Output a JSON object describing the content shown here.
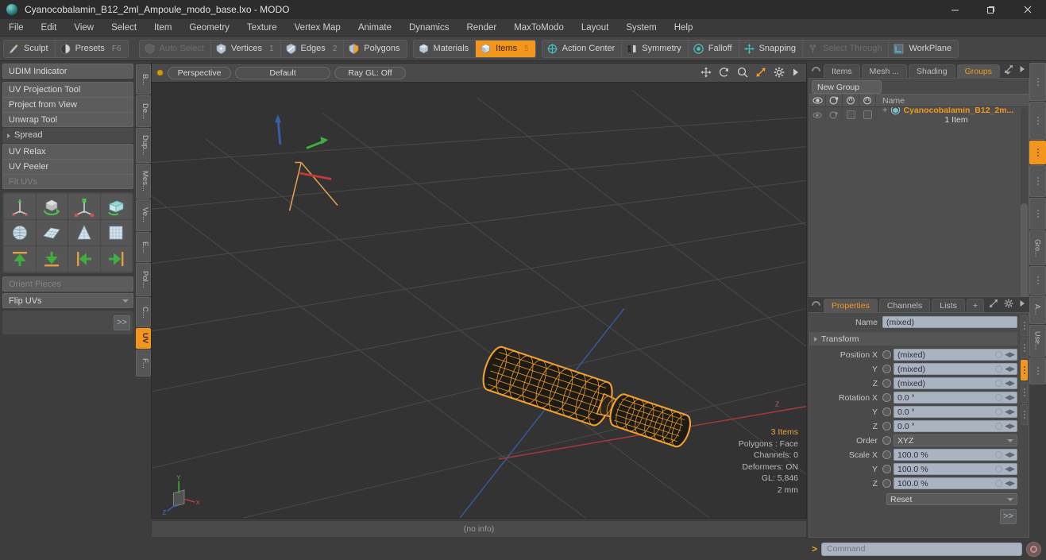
{
  "window": {
    "title": "Cyanocobalamin_B12_2ml_Ampoule_modo_base.lxo - MODO",
    "app_icon": "modo-logo-icon",
    "minimize": "—",
    "maximize": "❐",
    "close": "✕"
  },
  "menubar": {
    "items": [
      "File",
      "Edit",
      "View",
      "Select",
      "Item",
      "Geometry",
      "Texture",
      "Vertex Map",
      "Animate",
      "Dynamics",
      "Render",
      "MaxToModo",
      "Layout",
      "System",
      "Help"
    ]
  },
  "toolbar": {
    "group1": [
      {
        "label": "Sculpt",
        "icon": "sculpt-brush-icon",
        "badge": "",
        "state": "normal"
      },
      {
        "label": "Presets",
        "icon": "presets-sphere-icon",
        "badge": "F6",
        "state": "normal"
      }
    ],
    "group2": [
      {
        "label": "Auto Select",
        "icon": "auto-select-icon",
        "badge": "",
        "state": "disabled"
      },
      {
        "label": "Vertices",
        "icon": "vertices-icon",
        "badge": "1",
        "state": "normal"
      },
      {
        "label": "Edges",
        "icon": "edges-icon",
        "badge": "2",
        "state": "normal"
      },
      {
        "label": "Polygons",
        "icon": "polygons-icon",
        "badge": "",
        "state": "normal"
      }
    ],
    "group3": [
      {
        "label": "Materials",
        "icon": "materials-icon",
        "badge": "",
        "state": "normal"
      },
      {
        "label": "Items",
        "icon": "items-icon",
        "badge": "5",
        "state": "active"
      }
    ],
    "group4": [
      {
        "label": "Action Center",
        "icon": "action-center-icon",
        "badge": "",
        "state": "normal"
      },
      {
        "label": "Symmetry",
        "icon": "symmetry-icon",
        "badge": "",
        "state": "normal"
      },
      {
        "label": "Falloff",
        "icon": "falloff-icon",
        "badge": "",
        "state": "normal"
      },
      {
        "label": "Snapping",
        "icon": "snapping-icon",
        "badge": "",
        "state": "normal"
      },
      {
        "label": "Select Through",
        "icon": "select-through-icon",
        "badge": "",
        "state": "disabled"
      },
      {
        "label": "WorkPlane",
        "icon": "workplane-icon",
        "badge": "",
        "state": "normal"
      }
    ]
  },
  "left_panel": {
    "udim": "UDIM Indicator",
    "tools": [
      "UV Projection Tool",
      "Project from View",
      "Unwrap Tool"
    ],
    "spread_header": "Spread",
    "relax_tools": [
      "UV Relax",
      "UV Peeler"
    ],
    "fit_uvs": "Fit UVs",
    "icon_row1": [
      "uv-move-gizmo-icon",
      "uv-rotate-cube-icon",
      "uv-scale-gizmo-icon",
      "uv-unwrap-box-icon"
    ],
    "icon_row2": [
      "uv-sphere-map-icon",
      "uv-planar-map-icon",
      "uv-cone-map-icon",
      "uv-box-map-icon"
    ],
    "icon_row3": [
      "uv-align-up-icon",
      "uv-align-down-icon",
      "uv-align-left-icon",
      "uv-align-right-icon"
    ],
    "orient_pieces": "Orient Pieces",
    "flip_uvs": "Flip UVs",
    "more_button": ">>",
    "vtabs": [
      "B...",
      "De...",
      "Dup...",
      "Mes...",
      "Ve...",
      "E...",
      "Pol...",
      "C...",
      "UV",
      "F..."
    ],
    "vtab_active_index": 8
  },
  "viewport": {
    "view_mode": "Perspective",
    "shading": "Default",
    "raygl": "Ray GL: Off",
    "tools": [
      "pan-icon",
      "rotate-icon",
      "zoom-icon",
      "fit-icon",
      "gear-icon",
      "play-arrow-icon"
    ],
    "stats": {
      "items": "3 Items",
      "polygons": "Polygons : Face",
      "channels": "Channels: 0",
      "deformers": "Deformers: ON",
      "gl": "GL: 5,846",
      "scale": "2 mm"
    },
    "axis_gizmo": {
      "x": "X",
      "y": "Y",
      "z": "Z",
      "x_color": "#d04040",
      "y_color": "#40b040",
      "z_color": "#4060d0"
    },
    "mesh_color": "#f0a030",
    "background": "#333333",
    "status": "(no info)"
  },
  "right_panel": {
    "top_tabs": [
      "Items",
      "Mesh ...",
      "Shading",
      "Groups"
    ],
    "top_tab_active": 3,
    "new_group": "New Group",
    "tree_header": {
      "name": "Name",
      "cols": [
        "eye-icon",
        "render-icon",
        "lock-icon",
        "select-icon"
      ]
    },
    "tree_rows": [
      {
        "label": "Cyanocobalamin_B12_2m...",
        "sub": "1 Item",
        "icon": "group-item-icon"
      }
    ],
    "prop_tabs": [
      "Properties",
      "Channels",
      "Lists",
      "+"
    ],
    "prop_tab_active": 0,
    "name_label": "Name",
    "name_value": "(mixed)",
    "transform_header": "Transform",
    "fields": [
      {
        "label": "Position X",
        "value": "(mixed)",
        "type": "num"
      },
      {
        "label": "Y",
        "value": "(mixed)",
        "type": "num"
      },
      {
        "label": "Z",
        "value": "(mixed)",
        "type": "num"
      },
      {
        "label": "Rotation X",
        "value": "0.0 °",
        "type": "num"
      },
      {
        "label": "Y",
        "value": "0.0 °",
        "type": "num"
      },
      {
        "label": "Z",
        "value": "0.0 °",
        "type": "num"
      },
      {
        "label": "Order",
        "value": "XYZ",
        "type": "select"
      },
      {
        "label": "Scale X",
        "value": "100.0 %",
        "type": "num"
      },
      {
        "label": "Y",
        "value": "100.0 %",
        "type": "num"
      },
      {
        "label": "Z",
        "value": "100.0 %",
        "type": "num"
      }
    ],
    "reset": "Reset",
    "more_button": ">>",
    "vtabs": [
      "Gro...",
      "A...",
      "Use..."
    ]
  },
  "command_bar": {
    "prompt": ">",
    "placeholder": "Command",
    "record_icon": "record-icon"
  },
  "colors": {
    "accent": "#f2961e",
    "panel": "#4a4a4a",
    "field": "#aab4c0",
    "viewport_bg": "#333333"
  }
}
